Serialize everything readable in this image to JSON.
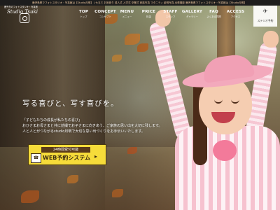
{
  "topbar": {
    "text": "鹿児島県でフォトスタジオ・写真館は【Studio月明】 | 七五三 お宮参り 成人式 入学式 卒業式 家族写真 マタニティ 証明写真 出張撮影 鹿児島県でフォトスタジオ・写真館は【Studio月明】"
  },
  "logo": {
    "small": "鹿児島のフォトスタジオ・写真館",
    "name": "Studio Tsuki"
  },
  "nav": [
    {
      "en": "TOP",
      "jp": "トップ"
    },
    {
      "en": "CONCEPT",
      "jp": "コンセプト"
    },
    {
      "en": "MENU",
      "jp": "メニュー"
    },
    {
      "en": "PRICE",
      "jp": "料金"
    },
    {
      "en": "STAFF",
      "jp": "スタッフ"
    },
    {
      "en": "GALLERY",
      "jp": "ギャラリー"
    },
    {
      "en": "FAQ",
      "jp": "よくある質問"
    },
    {
      "en": "ACCESS",
      "jp": "アクセス"
    }
  ],
  "cta": {
    "icon": "paper-plane-icon",
    "label": "ステジオ予約"
  },
  "hero": {
    "tagline": "写る喜びと、写す喜びを。",
    "lines": [
      "「子どもたちの成長が私たちの喜び」",
      "おひさまお母さまと共に前撮でお子さまに向きあう、ご家族の思い出を大切に残します。",
      "人と人とがつながるstudio月明で大切な思い出づくりをお手伝いいたします。"
    ]
  },
  "booking": {
    "badge": "24時間受付可能",
    "main": "WEB予約システム"
  },
  "colors": {
    "accent_yellow": "#f6dc3a",
    "topbar": "#1d1d1d",
    "text_light": "#ffffff"
  }
}
